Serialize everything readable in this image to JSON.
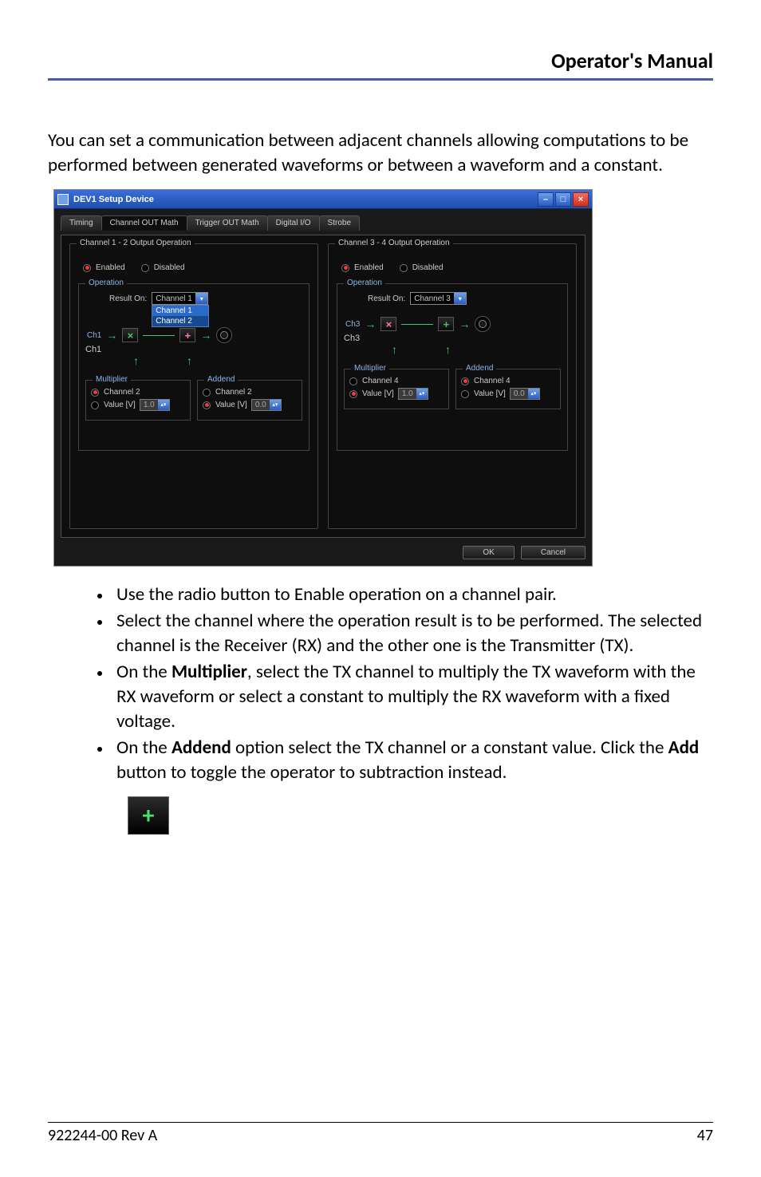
{
  "header": {
    "title": "Operator's Manual"
  },
  "intro": "You can set a communication between adjacent channels allowing computations to be performed between generated waveforms or between a waveform and a constant.",
  "dialog": {
    "title": "DEV1 Setup Device",
    "tabs": [
      "Timing",
      "Channel OUT Math",
      "Trigger OUT Math",
      "Digital I/O",
      "Strobe"
    ],
    "active_tab": 1,
    "panels": [
      {
        "title": "Channel 1 - 2 Output Operation",
        "enable": {
          "enabled_label": "Enabled",
          "disabled_label": "Disabled",
          "selected": "enabled"
        },
        "operation": {
          "legend": "Operation",
          "result_on_label": "Result On:",
          "result_on_value": "Channel 1",
          "result_on_options": [
            "Channel 1",
            "Channel 2"
          ],
          "show_dropdown": true,
          "chain_in": "Ch1",
          "chain_out": "Ch1",
          "add_symbol": "+",
          "multiplier": {
            "legend": "Multiplier",
            "channel_label": "Channel 2",
            "channel_selected": true,
            "value_label": "Value [V]",
            "value": "1.0",
            "value_selected": false
          },
          "addend": {
            "legend": "Addend",
            "channel_label": "Channel 2",
            "channel_selected": false,
            "value_label": "Value [V]",
            "value": "0.0",
            "value_selected": true
          }
        }
      },
      {
        "title": "Channel 3 - 4 Output Operation",
        "enable": {
          "enabled_label": "Enabled",
          "disabled_label": "Disabled",
          "selected": "enabled"
        },
        "operation": {
          "legend": "Operation",
          "result_on_label": "Result On:",
          "result_on_value": "Channel 3",
          "show_dropdown": false,
          "chain_in": "Ch3",
          "chain_out": "Ch3",
          "add_symbol": "+",
          "multiplier": {
            "legend": "Multiplier",
            "channel_label": "Channel 4",
            "channel_selected": false,
            "value_label": "Value [V]",
            "value": "1.0",
            "value_selected": true
          },
          "addend": {
            "legend": "Addend",
            "channel_label": "Channel 4",
            "channel_selected": true,
            "value_label": "Value [V]",
            "value": "0.0",
            "value_selected": false
          }
        }
      }
    ],
    "buttons": {
      "ok": "OK",
      "cancel": "Cancel"
    }
  },
  "bullets": [
    "Use the radio button to Enable operation on a channel pair.",
    "Select the channel where the operation result is to be performed. The selected channel is the Receiver (RX) and the other one is the Transmitter (TX).",
    "On the <b>Multiplier</b>, select the TX channel to multiply the TX waveform with the RX waveform or select a constant to multiply the RX waveform with a fixed voltage.",
    "On the <b>Addend</b> option select the TX channel or a constant value. Click the <b>Add</b> button to toggle the operator to subtraction instead."
  ],
  "footer": {
    "left": "922244-00 Rev A",
    "right": "47"
  }
}
